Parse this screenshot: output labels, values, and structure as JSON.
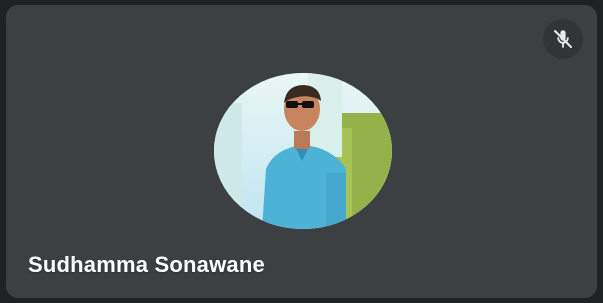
{
  "participant": {
    "name": "Sudhamma Sonawane"
  },
  "status": {
    "microphone": "muted",
    "icon": "microphone-off-icon"
  },
  "colors": {
    "tile_background": "#3c4043",
    "page_background": "#202124",
    "name_text": "#ffffff",
    "badge_background": "#323538"
  }
}
